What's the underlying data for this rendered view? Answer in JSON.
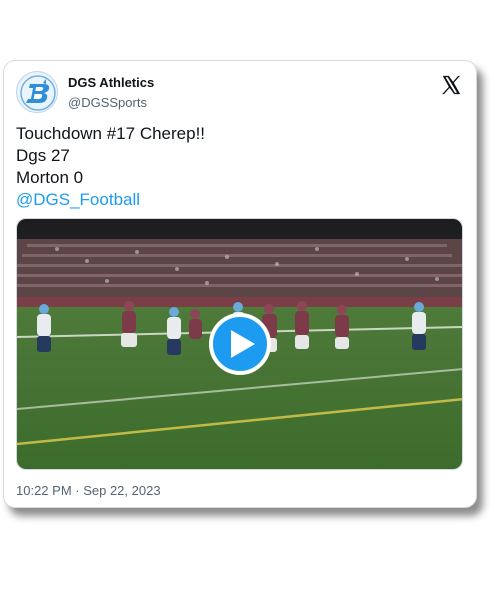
{
  "account": {
    "display_name": "DGS Athletics",
    "handle": "@DGSSports",
    "avatar_icon": "dgs-blue-devil-logo"
  },
  "platform_icon": "x-logo-icon",
  "tweet": {
    "lines": [
      "Touchdown #17 Cherep!!",
      "Dgs 27",
      "Morton 0"
    ],
    "mention": "@DGS_Football"
  },
  "media": {
    "type": "video",
    "play_icon": "play-icon"
  },
  "timestamp": "10:22 PM · Sep 22, 2023",
  "colors": {
    "link": "#1d9bf0",
    "play_button": "#1d9bf0",
    "text": "#0f1419",
    "secondary": "#536471"
  }
}
